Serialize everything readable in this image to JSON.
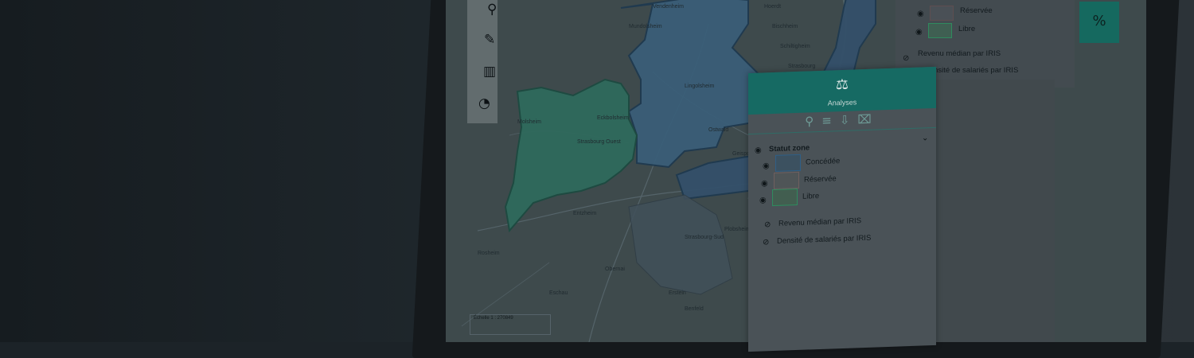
{
  "panel": {
    "title": "Analyses",
    "group_label": "Statut zone",
    "legend": [
      {
        "label": "Concédée",
        "color": "#2f5f86"
      },
      {
        "label": "Réservée",
        "color": "#6e5f5f"
      },
      {
        "label": "Libre",
        "color": "#2f8a5e"
      }
    ],
    "layers": [
      {
        "label": "Revenu médian par IRIS"
      },
      {
        "label": "Densité de salariés par IRIS"
      }
    ]
  },
  "back_panel": {
    "legend": [
      {
        "label": "Réservée"
      },
      {
        "label": "Libre"
      }
    ],
    "layers": [
      {
        "label": "Revenu médian par IRIS"
      },
      {
        "label": "Densité de salariés par IRIS"
      }
    ]
  },
  "map": {
    "scale_label": "Échelle 1 : 270849",
    "places": [
      "Strasbourg",
      "Schiltigheim",
      "Bischheim",
      "Strasbourg-Sud",
      "Strasbourg Ouest",
      "Ostwald",
      "Geispolsheim",
      "Entzheim",
      "Illkirch",
      "Lingolsheim",
      "Eckbolsheim",
      "Molsheim",
      "Obernai",
      "Erstein",
      "Rosheim",
      "Benfeld",
      "Mundolsheim",
      "Vendenheim",
      "Plobsheim",
      "Eschau",
      "Hoerdt"
    ]
  }
}
